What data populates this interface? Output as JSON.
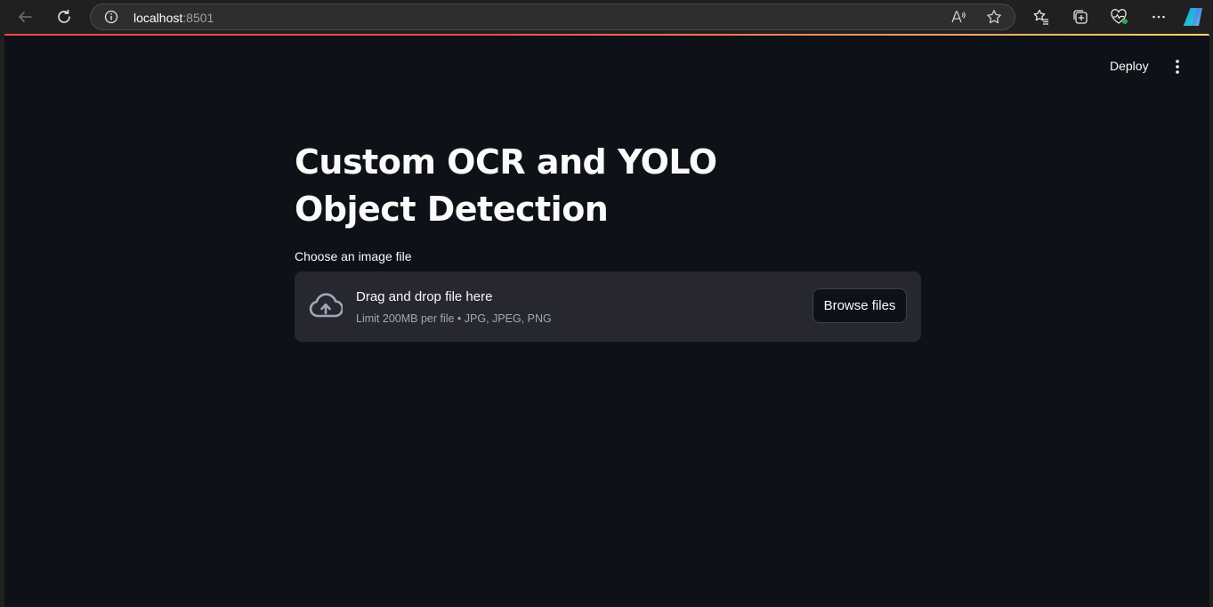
{
  "browser": {
    "url_host": "localhost",
    "url_port": ":8501",
    "icons": [
      "back-icon",
      "refresh-icon",
      "site-info-icon",
      "read-aloud-icon",
      "favorite-star-icon",
      "favorites-icon",
      "collections-icon",
      "browser-essentials-icon",
      "more-icon",
      "copilot-icon"
    ]
  },
  "app": {
    "deploy_label": "Deploy",
    "title": "Custom OCR and YOLO Object Detection",
    "uploader": {
      "label": "Choose an image file",
      "drop_text": "Drag and drop file here",
      "limit_text": "Limit 200MB per file • JPG, JPEG, PNG",
      "browse_label": "Browse files"
    }
  },
  "colors": {
    "page_bg": "#0e1117",
    "dropzone_bg": "#262730",
    "accent": "#ff4b4b",
    "chrome_bg": "#202020"
  }
}
